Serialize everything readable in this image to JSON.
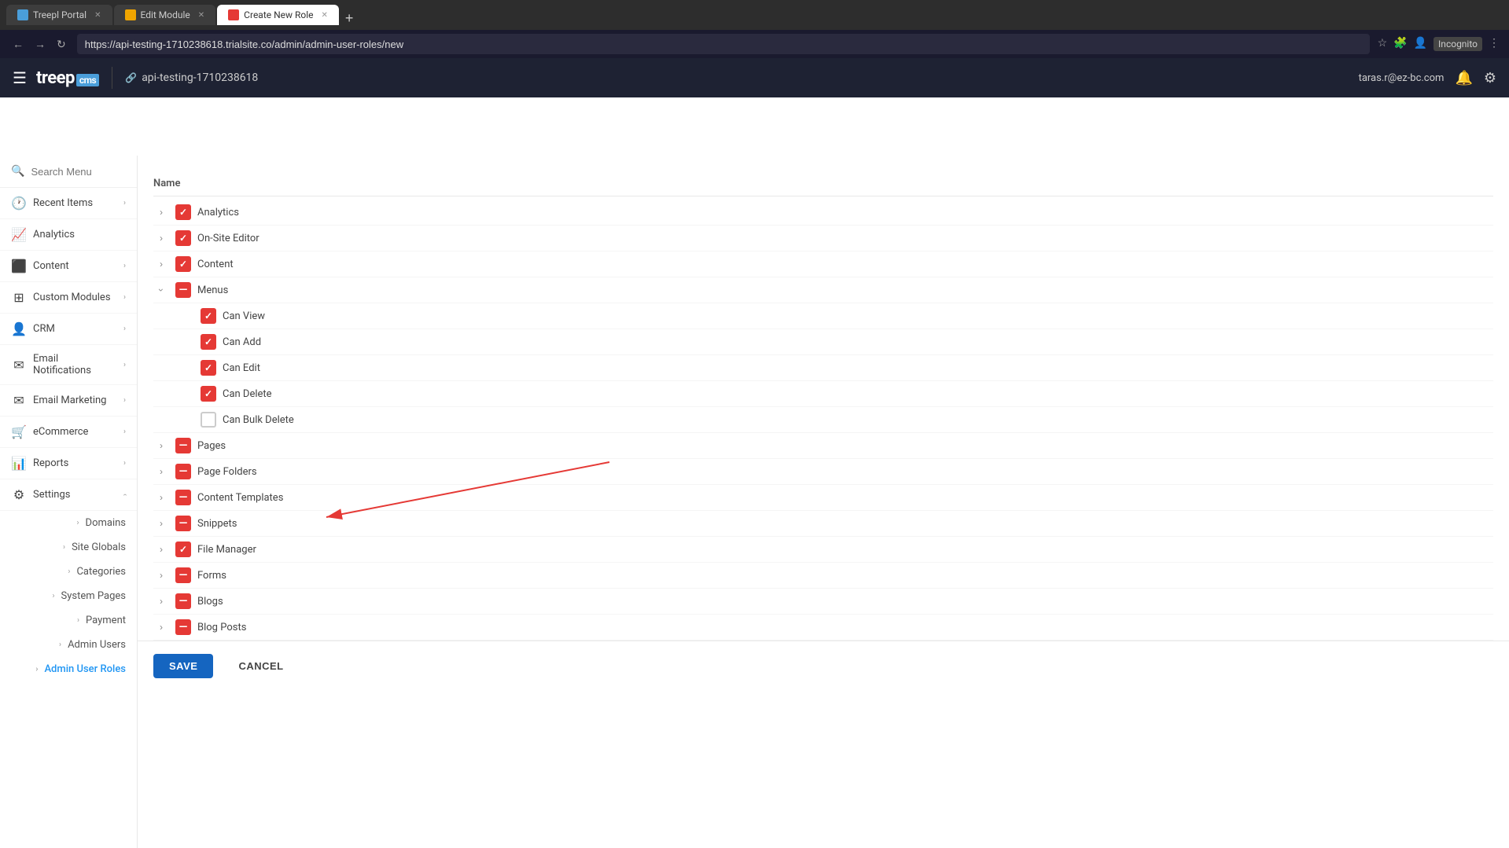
{
  "browser": {
    "tabs": [
      {
        "id": "treepl",
        "label": "Treepl Portal",
        "active": false,
        "favicon_color": "#4a9eda"
      },
      {
        "id": "edit-module",
        "label": "Edit Module",
        "active": false,
        "favicon_color": "#f0a500"
      },
      {
        "id": "create-role",
        "label": "Create New Role",
        "active": true,
        "favicon_color": "#e53935"
      }
    ],
    "url": "https://api-testing-1710238618.trialsite.co/admin/admin-user-roles/new",
    "incognito_label": "Incognito"
  },
  "topbar": {
    "logo": "treep",
    "cms_badge": "cms",
    "divider": true,
    "site_icon": "🔗",
    "site_name": "api-testing-1710238618",
    "user_email": "taras.r@ez-bc.com"
  },
  "sidebar": {
    "search_placeholder": "Search Menu",
    "items": [
      {
        "id": "recent-items",
        "label": "Recent Items",
        "icon": "🕐",
        "has_children": true
      },
      {
        "id": "analytics",
        "label": "Analytics",
        "icon": "📈",
        "has_children": false
      },
      {
        "id": "content",
        "label": "Content",
        "icon": "⬛",
        "has_children": true
      },
      {
        "id": "custom-modules",
        "label": "Custom Modules",
        "icon": "⊞",
        "has_children": true
      },
      {
        "id": "crm",
        "label": "CRM",
        "icon": "👤",
        "has_children": true
      },
      {
        "id": "email-notifications",
        "label": "Email Notifications",
        "icon": "✉",
        "has_children": true
      },
      {
        "id": "email-marketing",
        "label": "Email Marketing",
        "icon": "✉",
        "has_children": true
      },
      {
        "id": "ecommerce",
        "label": "eCommerce",
        "icon": "🛒",
        "has_children": true
      },
      {
        "id": "reports",
        "label": "Reports",
        "icon": "📊",
        "has_children": true
      },
      {
        "id": "settings",
        "label": "Settings",
        "icon": "⚙",
        "has_children": true,
        "expanded": true
      }
    ],
    "settings_subitems": [
      {
        "id": "domains",
        "label": "Domains"
      },
      {
        "id": "site-globals",
        "label": "Site Globals"
      },
      {
        "id": "categories",
        "label": "Categories"
      },
      {
        "id": "system-pages",
        "label": "System Pages"
      },
      {
        "id": "payment",
        "label": "Payment"
      },
      {
        "id": "admin-users",
        "label": "Admin Users"
      },
      {
        "id": "admin-user-roles",
        "label": "Admin User Roles",
        "active": true
      }
    ]
  },
  "permissions": {
    "header_label": "Name",
    "items": [
      {
        "id": "analytics",
        "label": "Analytics",
        "state": "checked",
        "expanded": false,
        "indent": 0
      },
      {
        "id": "on-site-editor",
        "label": "On-Site Editor",
        "state": "checked",
        "expanded": false,
        "indent": 0
      },
      {
        "id": "content",
        "label": "Content",
        "state": "checked",
        "expanded": false,
        "indent": 0
      },
      {
        "id": "menus",
        "label": "Menus",
        "state": "partial",
        "expanded": true,
        "indent": 0
      },
      {
        "id": "menus-can-view",
        "label": "Can View",
        "state": "checked",
        "indent": 1
      },
      {
        "id": "menus-can-add",
        "label": "Can Add",
        "state": "checked",
        "indent": 1
      },
      {
        "id": "menus-can-edit",
        "label": "Can Edit",
        "state": "checked",
        "indent": 1
      },
      {
        "id": "menus-can-delete",
        "label": "Can Delete",
        "state": "checked",
        "indent": 1
      },
      {
        "id": "menus-can-bulk-delete",
        "label": "Can Bulk Delete",
        "state": "unchecked",
        "indent": 1
      },
      {
        "id": "pages",
        "label": "Pages",
        "state": "partial",
        "expanded": false,
        "indent": 0
      },
      {
        "id": "page-folders",
        "label": "Page Folders",
        "state": "partial",
        "expanded": false,
        "indent": 0
      },
      {
        "id": "content-templates",
        "label": "Content Templates",
        "state": "partial",
        "expanded": false,
        "indent": 0
      },
      {
        "id": "snippets",
        "label": "Snippets",
        "state": "partial",
        "expanded": false,
        "indent": 0
      },
      {
        "id": "file-manager",
        "label": "File Manager",
        "state": "checked",
        "expanded": false,
        "indent": 0
      },
      {
        "id": "forms",
        "label": "Forms",
        "state": "partial",
        "expanded": false,
        "indent": 0
      },
      {
        "id": "blogs",
        "label": "Blogs",
        "state": "partial",
        "expanded": false,
        "indent": 0
      },
      {
        "id": "blog-posts",
        "label": "Blog Posts",
        "state": "partial",
        "expanded": false,
        "indent": 0
      }
    ]
  },
  "actions": {
    "save_label": "SAVE",
    "cancel_label": "CANCEL"
  },
  "colors": {
    "checked": "#e53935",
    "partial": "#e53935",
    "unchecked_border": "#ccc",
    "active_blue": "#2196f3",
    "sidebar_bg": "#ffffff",
    "topbar_bg": "#1e2233"
  }
}
